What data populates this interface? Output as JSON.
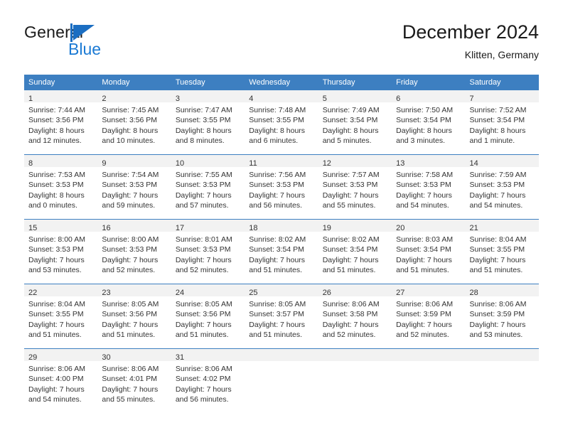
{
  "brand": {
    "name_part1": "General",
    "name_part2": "Blue",
    "mark": "triangle-logo",
    "accent_color": "#1b6ec2",
    "accent_color_light": "#1b7ad4"
  },
  "header": {
    "title": "December 2024",
    "subtitle": "Klitten, Germany"
  },
  "theme": {
    "header_row_bg": "#3d7fc1",
    "header_row_text": "#ffffff",
    "daynum_band_bg": "#f2f2f2",
    "cell_bg": "#ffffff",
    "week_separator": "#3d7fc1",
    "text": "#333333"
  },
  "weekdays": [
    "Sunday",
    "Monday",
    "Tuesday",
    "Wednesday",
    "Thursday",
    "Friday",
    "Saturday"
  ],
  "weeks": [
    [
      {
        "day": "1",
        "sunrise": "Sunrise: 7:44 AM",
        "sunset": "Sunset: 3:56 PM",
        "daylight1": "Daylight: 8 hours",
        "daylight2": "and 12 minutes."
      },
      {
        "day": "2",
        "sunrise": "Sunrise: 7:45 AM",
        "sunset": "Sunset: 3:56 PM",
        "daylight1": "Daylight: 8 hours",
        "daylight2": "and 10 minutes."
      },
      {
        "day": "3",
        "sunrise": "Sunrise: 7:47 AM",
        "sunset": "Sunset: 3:55 PM",
        "daylight1": "Daylight: 8 hours",
        "daylight2": "and 8 minutes."
      },
      {
        "day": "4",
        "sunrise": "Sunrise: 7:48 AM",
        "sunset": "Sunset: 3:55 PM",
        "daylight1": "Daylight: 8 hours",
        "daylight2": "and 6 minutes."
      },
      {
        "day": "5",
        "sunrise": "Sunrise: 7:49 AM",
        "sunset": "Sunset: 3:54 PM",
        "daylight1": "Daylight: 8 hours",
        "daylight2": "and 5 minutes."
      },
      {
        "day": "6",
        "sunrise": "Sunrise: 7:50 AM",
        "sunset": "Sunset: 3:54 PM",
        "daylight1": "Daylight: 8 hours",
        "daylight2": "and 3 minutes."
      },
      {
        "day": "7",
        "sunrise": "Sunrise: 7:52 AM",
        "sunset": "Sunset: 3:54 PM",
        "daylight1": "Daylight: 8 hours",
        "daylight2": "and 1 minute."
      }
    ],
    [
      {
        "day": "8",
        "sunrise": "Sunrise: 7:53 AM",
        "sunset": "Sunset: 3:53 PM",
        "daylight1": "Daylight: 8 hours",
        "daylight2": "and 0 minutes."
      },
      {
        "day": "9",
        "sunrise": "Sunrise: 7:54 AM",
        "sunset": "Sunset: 3:53 PM",
        "daylight1": "Daylight: 7 hours",
        "daylight2": "and 59 minutes."
      },
      {
        "day": "10",
        "sunrise": "Sunrise: 7:55 AM",
        "sunset": "Sunset: 3:53 PM",
        "daylight1": "Daylight: 7 hours",
        "daylight2": "and 57 minutes."
      },
      {
        "day": "11",
        "sunrise": "Sunrise: 7:56 AM",
        "sunset": "Sunset: 3:53 PM",
        "daylight1": "Daylight: 7 hours",
        "daylight2": "and 56 minutes."
      },
      {
        "day": "12",
        "sunrise": "Sunrise: 7:57 AM",
        "sunset": "Sunset: 3:53 PM",
        "daylight1": "Daylight: 7 hours",
        "daylight2": "and 55 minutes."
      },
      {
        "day": "13",
        "sunrise": "Sunrise: 7:58 AM",
        "sunset": "Sunset: 3:53 PM",
        "daylight1": "Daylight: 7 hours",
        "daylight2": "and 54 minutes."
      },
      {
        "day": "14",
        "sunrise": "Sunrise: 7:59 AM",
        "sunset": "Sunset: 3:53 PM",
        "daylight1": "Daylight: 7 hours",
        "daylight2": "and 54 minutes."
      }
    ],
    [
      {
        "day": "15",
        "sunrise": "Sunrise: 8:00 AM",
        "sunset": "Sunset: 3:53 PM",
        "daylight1": "Daylight: 7 hours",
        "daylight2": "and 53 minutes."
      },
      {
        "day": "16",
        "sunrise": "Sunrise: 8:00 AM",
        "sunset": "Sunset: 3:53 PM",
        "daylight1": "Daylight: 7 hours",
        "daylight2": "and 52 minutes."
      },
      {
        "day": "17",
        "sunrise": "Sunrise: 8:01 AM",
        "sunset": "Sunset: 3:53 PM",
        "daylight1": "Daylight: 7 hours",
        "daylight2": "and 52 minutes."
      },
      {
        "day": "18",
        "sunrise": "Sunrise: 8:02 AM",
        "sunset": "Sunset: 3:54 PM",
        "daylight1": "Daylight: 7 hours",
        "daylight2": "and 51 minutes."
      },
      {
        "day": "19",
        "sunrise": "Sunrise: 8:02 AM",
        "sunset": "Sunset: 3:54 PM",
        "daylight1": "Daylight: 7 hours",
        "daylight2": "and 51 minutes."
      },
      {
        "day": "20",
        "sunrise": "Sunrise: 8:03 AM",
        "sunset": "Sunset: 3:54 PM",
        "daylight1": "Daylight: 7 hours",
        "daylight2": "and 51 minutes."
      },
      {
        "day": "21",
        "sunrise": "Sunrise: 8:04 AM",
        "sunset": "Sunset: 3:55 PM",
        "daylight1": "Daylight: 7 hours",
        "daylight2": "and 51 minutes."
      }
    ],
    [
      {
        "day": "22",
        "sunrise": "Sunrise: 8:04 AM",
        "sunset": "Sunset: 3:55 PM",
        "daylight1": "Daylight: 7 hours",
        "daylight2": "and 51 minutes."
      },
      {
        "day": "23",
        "sunrise": "Sunrise: 8:05 AM",
        "sunset": "Sunset: 3:56 PM",
        "daylight1": "Daylight: 7 hours",
        "daylight2": "and 51 minutes."
      },
      {
        "day": "24",
        "sunrise": "Sunrise: 8:05 AM",
        "sunset": "Sunset: 3:56 PM",
        "daylight1": "Daylight: 7 hours",
        "daylight2": "and 51 minutes."
      },
      {
        "day": "25",
        "sunrise": "Sunrise: 8:05 AM",
        "sunset": "Sunset: 3:57 PM",
        "daylight1": "Daylight: 7 hours",
        "daylight2": "and 51 minutes."
      },
      {
        "day": "26",
        "sunrise": "Sunrise: 8:06 AM",
        "sunset": "Sunset: 3:58 PM",
        "daylight1": "Daylight: 7 hours",
        "daylight2": "and 52 minutes."
      },
      {
        "day": "27",
        "sunrise": "Sunrise: 8:06 AM",
        "sunset": "Sunset: 3:59 PM",
        "daylight1": "Daylight: 7 hours",
        "daylight2": "and 52 minutes."
      },
      {
        "day": "28",
        "sunrise": "Sunrise: 8:06 AM",
        "sunset": "Sunset: 3:59 PM",
        "daylight1": "Daylight: 7 hours",
        "daylight2": "and 53 minutes."
      }
    ],
    [
      {
        "day": "29",
        "sunrise": "Sunrise: 8:06 AM",
        "sunset": "Sunset: 4:00 PM",
        "daylight1": "Daylight: 7 hours",
        "daylight2": "and 54 minutes."
      },
      {
        "day": "30",
        "sunrise": "Sunrise: 8:06 AM",
        "sunset": "Sunset: 4:01 PM",
        "daylight1": "Daylight: 7 hours",
        "daylight2": "and 55 minutes."
      },
      {
        "day": "31",
        "sunrise": "Sunrise: 8:06 AM",
        "sunset": "Sunset: 4:02 PM",
        "daylight1": "Daylight: 7 hours",
        "daylight2": "and 56 minutes."
      },
      {
        "day": "",
        "sunrise": "",
        "sunset": "",
        "daylight1": "",
        "daylight2": ""
      },
      {
        "day": "",
        "sunrise": "",
        "sunset": "",
        "daylight1": "",
        "daylight2": ""
      },
      {
        "day": "",
        "sunrise": "",
        "sunset": "",
        "daylight1": "",
        "daylight2": ""
      },
      {
        "day": "",
        "sunrise": "",
        "sunset": "",
        "daylight1": "",
        "daylight2": ""
      }
    ]
  ]
}
